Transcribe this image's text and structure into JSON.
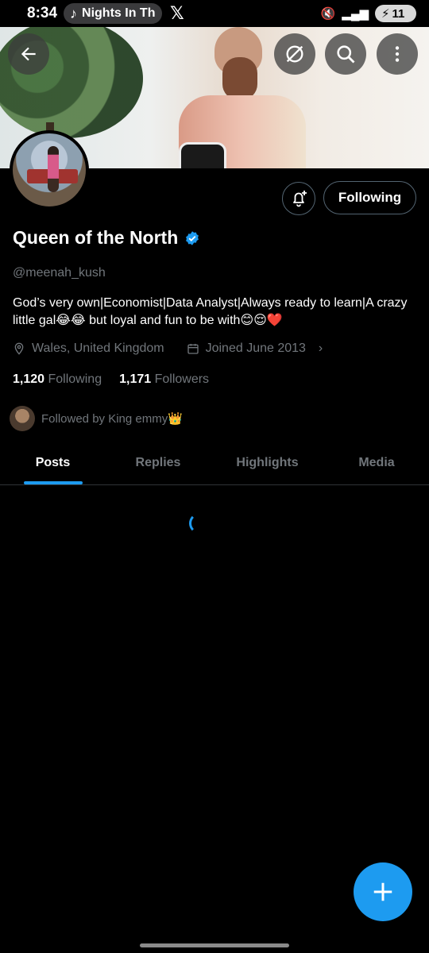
{
  "status_bar": {
    "time": "8:34",
    "media_title": "Nights In Th",
    "battery": "11"
  },
  "header": {
    "back_icon": "arrow-left-icon",
    "mute_icon": "slash-circle-icon",
    "search_icon": "search-icon",
    "more_icon": "more-vertical-icon"
  },
  "profile": {
    "name": "Queen of the North",
    "handle": "@meenah_kush",
    "bio": "God’s very own|Economist|Data Analyst|Always ready to learn|A crazy little gal😂😂 but loyal and fun to be with😊😌❤️",
    "location": "Wales, United Kingdom",
    "joined": "Joined June 2013",
    "following_count": "1,120",
    "following_label": "Following",
    "followers_count": "1,171",
    "followers_label": "Followers",
    "followed_by": "Followed by King emmy👑",
    "verified": true
  },
  "actions": {
    "following_button": "Following",
    "notify_icon": "bell-plus-icon"
  },
  "tabs": [
    {
      "label": "Posts",
      "active": true
    },
    {
      "label": "Replies",
      "active": false
    },
    {
      "label": "Highlights",
      "active": false
    },
    {
      "label": "Media",
      "active": false
    }
  ],
  "colors": {
    "accent": "#1d9bf0",
    "background": "#000000",
    "secondary_text": "#71767b"
  }
}
